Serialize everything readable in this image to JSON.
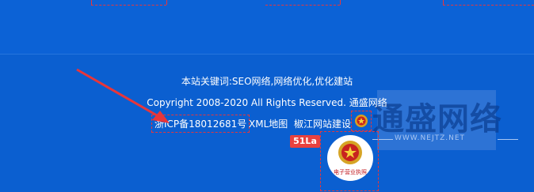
{
  "footer": {
    "keywords": "本站关键词:SEO网络,网络优化,优化建站",
    "copyright": "Copyright 2008-2020 All Rights Reserved. 通盛网络",
    "icp": "浙ICP备18012681号",
    "xml_link": "XML地图",
    "build_link": "椒江网站建设"
  },
  "stats_badge": "51La",
  "license_badge": "电子营业执照",
  "watermark": {
    "title": "通盛网络",
    "url": "WWW.NEJTZ.NET"
  },
  "colors": {
    "background": "#0b5fd0",
    "accent_red": "#e8363a",
    "badge_red": "#e8423f"
  }
}
